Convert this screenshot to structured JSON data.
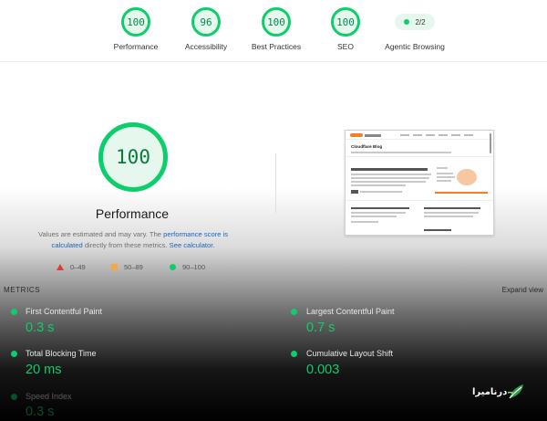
{
  "summary": {
    "gauges": [
      {
        "score": "100",
        "label": "Performance"
      },
      {
        "score": "96",
        "label": "Accessibility"
      },
      {
        "score": "100",
        "label": "Best Practices"
      },
      {
        "score": "100",
        "label": "SEO"
      }
    ],
    "agentic": {
      "value": "2/2",
      "label": "Agentic Browsing"
    }
  },
  "performance": {
    "score": "100",
    "title": "Performance",
    "desc_prefix": "Values are estimated and may vary. The ",
    "desc_link1": "performance score is calculated",
    "desc_mid": " directly from these metrics. ",
    "desc_link2": "See calculator."
  },
  "legend": {
    "fail": "0–49",
    "average": "50–89",
    "pass": "90–100"
  },
  "thumbnail": {
    "blog_title": "Cloudflare Blog"
  },
  "metrics": {
    "header": "METRICS",
    "expand": "Expand view",
    "items": [
      {
        "label": "First Contentful Paint",
        "value": "0.3 s"
      },
      {
        "label": "Largest Contentful Paint",
        "value": "0.7 s"
      },
      {
        "label": "Total Blocking Time",
        "value": "20 ms"
      },
      {
        "label": "Cumulative Layout Shift",
        "value": "0.003"
      },
      {
        "label": "Speed Index",
        "value": "0.3 s"
      }
    ]
  },
  "watermark": {
    "text": "درنامیرا"
  },
  "colors": {
    "pass": "#0cce6b",
    "average": "#f4a742",
    "fail": "#e53935",
    "link": "#1565c0"
  }
}
